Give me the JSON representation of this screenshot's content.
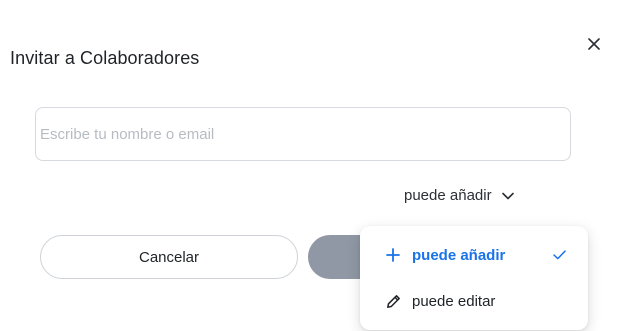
{
  "dialog": {
    "title": "Invitar a Colaboradores",
    "close_icon": "close-icon"
  },
  "search": {
    "placeholder": "Escribe tu nombre o email",
    "value": ""
  },
  "permission": {
    "selected_label": "puede añadir",
    "chevron_icon": "chevron-down-icon"
  },
  "actions": {
    "cancel_label": "Cancelar",
    "invite_label": ""
  },
  "menu": {
    "items": [
      {
        "label": "puede añadir",
        "icon": "plus-icon",
        "selected": true
      },
      {
        "label": "puede editar",
        "icon": "pencil-icon",
        "selected": false
      }
    ],
    "check_icon": "check-icon"
  },
  "colors": {
    "accent": "#1a73e8",
    "primary_button_disabled": "#8f98a4",
    "border": "#d6d9dd",
    "placeholder": "#b7bcc3"
  }
}
